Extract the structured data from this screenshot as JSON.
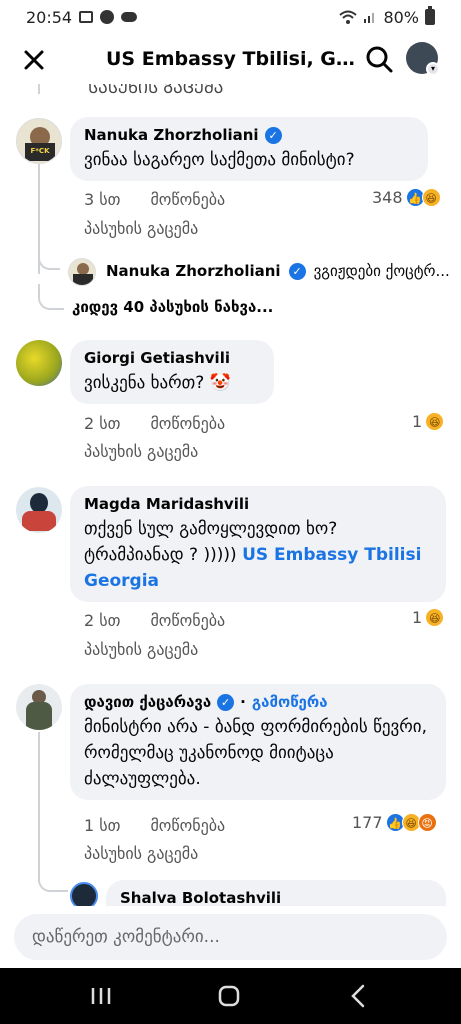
{
  "status_bar": {
    "time": "20:54",
    "battery": "80%"
  },
  "header": {
    "title": "US Embassy Tbilisi, Geor..."
  },
  "thread": {
    "clipped_text": "ᲡᲐᲡᲣᲮᲘᲡ ᲒᲐᲪᲔᲛᲐ",
    "comments": [
      {
        "author": "Nanuka Zhorzholiani",
        "text": "ვინაა საგარეო საქმეთა მინისტი?",
        "time": "3 სთ",
        "like": "მოწონება",
        "reply": "პასუხის გაცემა",
        "reaction_count": "348"
      },
      {
        "author": "Giorgi Getiashvili",
        "text": "ვისკენა ხართ? 🤡",
        "time": "2 სთ",
        "like": "მოწონება",
        "reply": "პასუხის გაცემა",
        "reaction_count": "1"
      },
      {
        "author": "Magda Maridashvili",
        "text": "თქვენ სულ გამოყლევდით ხო? ტრამპიანად ? )))))",
        "mention": "US Embassy Tbilisi Georgia",
        "time": "2 სთ",
        "like": "მოწონება",
        "reply": "პასუხის გაცემა",
        "reaction_count": "1"
      },
      {
        "author": "დავით ქაცარავა",
        "follow": "გამოწერა",
        "text": "მინისტრი არა - ბანდ ფორმირების წევრი, რომელმაც უკანონოდ მიიტაცა ძალაუფლება.",
        "time": "1 სთ",
        "like": "მოწონება",
        "reply": "პასუხის გაცემა",
        "reaction_count": "177"
      }
    ],
    "nested_reply": {
      "author": "Nanuka Zhorzholiani",
      "snippet": "ვგიჟდები ქოცტრ..."
    },
    "more_replies": "კიდევ 40 პასუხის ნახვა...",
    "bottom_reply_author": "Shalva Bolotashvili"
  },
  "composer": {
    "placeholder": "დაწერეთ კომენტარი..."
  }
}
